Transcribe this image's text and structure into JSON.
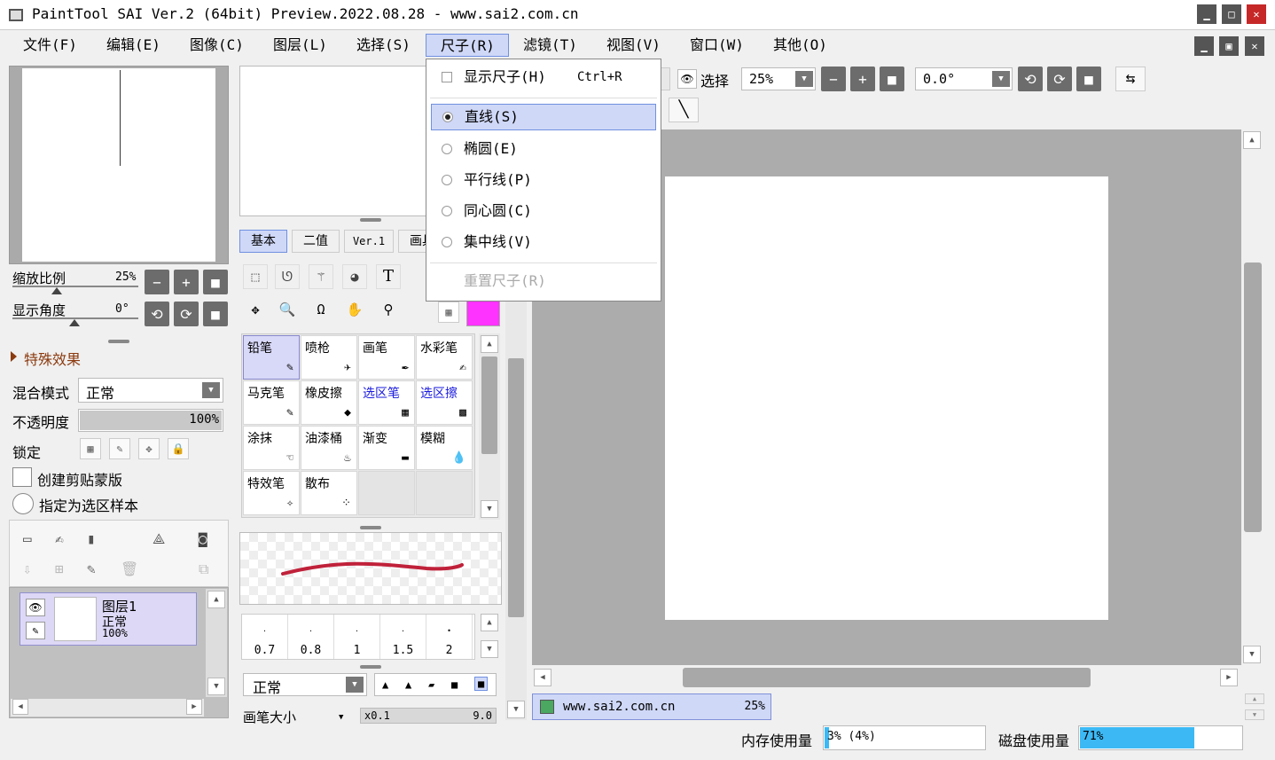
{
  "window": {
    "title": "PaintTool SAI Ver.2 (64bit) Preview.2022.08.28 - www.sai2.com.cn",
    "min": "▁",
    "max": "□",
    "close": "✕"
  },
  "menu": [
    "文件(F)",
    "编辑(E)",
    "图像(C)",
    "图层(L)",
    "选择(S)",
    "尺子(R)",
    "滤镜(T)",
    "视图(V)",
    "窗口(W)",
    "其他(O)"
  ],
  "mdi": {
    "min": "▁",
    "restore": "▣",
    "close": "✕"
  },
  "ruler_menu": {
    "show": "显示尺子(H)",
    "show_shortcut": "Ctrl+R",
    "items": [
      "直线(S)",
      "椭圆(E)",
      "平行线(P)",
      "同心圆(C)",
      "集中线(V)"
    ],
    "selected_index": 0,
    "reset": "重置尺子(R)"
  },
  "navigator": {
    "zoom_label": "缩放比例",
    "zoom_value": "25%",
    "angle_label": "显示角度",
    "angle_value": "0°"
  },
  "effects": {
    "label": "特殊效果"
  },
  "layer_props": {
    "blend_label": "混合模式",
    "blend_value": "正常",
    "opacity_label": "不透明度",
    "opacity_value": "100%",
    "opacity": 1.0,
    "lock_label": "锁定",
    "clip_label": "创建剪贴蒙版",
    "sample_label": "指定为选区样本"
  },
  "layers": [
    {
      "name": "图层1",
      "mode": "正常",
      "opacity": "100%"
    }
  ],
  "tool_tabs": [
    "基本",
    "二值",
    "Ver.1",
    "画具"
  ],
  "tools": [
    {
      "name": "铅笔",
      "icon": "✎",
      "blue": false,
      "sel": true
    },
    {
      "name": "喷枪",
      "icon": "✈",
      "blue": false,
      "sel": false
    },
    {
      "name": "画笔",
      "icon": "✒",
      "blue": false,
      "sel": false
    },
    {
      "name": "水彩笔",
      "icon": "✍",
      "blue": false,
      "sel": false
    },
    {
      "name": "马克笔",
      "icon": "✎",
      "blue": false,
      "sel": false
    },
    {
      "name": "橡皮擦",
      "icon": "◆",
      "blue": false,
      "sel": false
    },
    {
      "name": "选区笔",
      "icon": "▦",
      "blue": true,
      "sel": false
    },
    {
      "name": "选区擦",
      "icon": "▩",
      "blue": true,
      "sel": false
    },
    {
      "name": "涂抹",
      "icon": "☜",
      "blue": false,
      "sel": false
    },
    {
      "name": "油漆桶",
      "icon": "♨",
      "blue": false,
      "sel": false
    },
    {
      "name": "渐变",
      "icon": "▬",
      "blue": false,
      "sel": false
    },
    {
      "name": "模糊",
      "icon": "💧",
      "blue": false,
      "sel": false
    },
    {
      "name": "特效笔",
      "icon": "✧",
      "blue": false,
      "sel": false
    },
    {
      "name": "散布",
      "icon": "⁘",
      "blue": false,
      "sel": false
    }
  ],
  "brush_sizes": [
    "0.7",
    "0.8",
    "1",
    "1.5",
    "2"
  ],
  "brush_mode": "正常",
  "brush_size_label": "画笔大小",
  "brush_size_min": "x0.1",
  "brush_size_value": "9.0",
  "view_toolbar": {
    "select_label": "选择",
    "zoom": "25%",
    "angle": "0.0°"
  },
  "doc_tab": {
    "name": "www.sai2.com.cn",
    "zoom": "25%"
  },
  "status": {
    "mem_label": "内存使用量",
    "mem_value": "3% (4%)",
    "mem": 0.03,
    "disk_label": "磁盘使用量",
    "disk_value": "71%",
    "disk": 0.71
  },
  "colors": {
    "accent": "#cfd8f7",
    "swatch": "#ff33ff",
    "stroke": "#c0213a",
    "disk_bar": "#3cb9f5"
  }
}
